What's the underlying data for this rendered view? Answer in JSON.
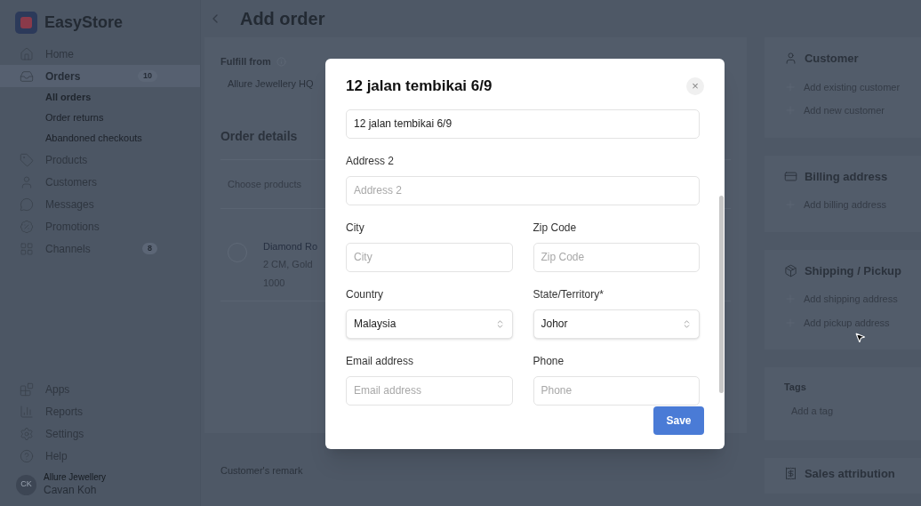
{
  "brand": {
    "name": "EasyStore"
  },
  "sidebar": {
    "items": [
      {
        "kind": "home",
        "label": "Home",
        "selected": false
      },
      {
        "kind": "orders",
        "label": "Orders",
        "selected": true,
        "badge": "10",
        "children": [
          {
            "label": "All orders",
            "selected": true
          },
          {
            "label": "Order returns",
            "selected": false
          },
          {
            "label": "Abandoned checkouts",
            "selected": false
          }
        ]
      },
      {
        "kind": "products",
        "label": "Products",
        "selected": false
      },
      {
        "kind": "customers",
        "label": "Customers",
        "selected": false
      },
      {
        "kind": "messages",
        "label": "Messages",
        "selected": false
      },
      {
        "kind": "promotions",
        "label": "Promotions",
        "selected": false
      },
      {
        "kind": "channels",
        "label": "Channels",
        "selected": false,
        "badge": "8"
      }
    ],
    "bottom_items": [
      {
        "kind": "apps",
        "label": "Apps"
      },
      {
        "kind": "reports",
        "label": "Reports"
      },
      {
        "kind": "settings",
        "label": "Settings"
      },
      {
        "kind": "help",
        "label": "Help"
      }
    ],
    "user": {
      "initials": "CK",
      "store": "Allure Jewellery",
      "name": "Cavan Koh"
    }
  },
  "page": {
    "title": "Add order"
  },
  "main": {
    "fulfill_label": "Fulfill from",
    "fulfill_value": "Allure Jewellery HQ",
    "order_details": "Order details",
    "choose_products": "Choose products",
    "product": {
      "name": "Diamond Ro",
      "variant": "2 CM, Gold",
      "price": "1000"
    },
    "remark_label": "Customer's remark"
  },
  "right_panel": [
    {
      "kind": "customer",
      "title": "Customer",
      "actions": [
        "Add existing customer",
        "Add new customer"
      ]
    },
    {
      "kind": "billing",
      "title": "Billing address",
      "actions": [
        "Add billing address"
      ]
    },
    {
      "kind": "shipping",
      "title": "Shipping / Pickup",
      "actions": [
        "Add shipping address",
        "Add pickup address"
      ]
    },
    {
      "kind": "tags",
      "title": "Tags",
      "placeholder": "Add a tag"
    },
    {
      "kind": "sales",
      "title": "Sales attribution"
    }
  ],
  "modal": {
    "title": "12 jalan tembikai 6/9",
    "close": "×",
    "rows": [
      [
        {
          "kind": "text",
          "value": "12 jalan tembikai 6/9"
        }
      ],
      [
        {
          "kind": "text",
          "label": "Address 2",
          "placeholder": "Address 2"
        }
      ],
      [
        {
          "kind": "text",
          "label": "City",
          "placeholder": "City"
        },
        {
          "kind": "text",
          "label": "Zip Code",
          "placeholder": "Zip Code"
        }
      ],
      [
        {
          "kind": "select",
          "label": "Country",
          "value": "Malaysia"
        },
        {
          "kind": "select",
          "label": "State/Territory*",
          "value": "Johor"
        }
      ],
      [
        {
          "kind": "text",
          "label": "Email address",
          "placeholder": "Email address"
        },
        {
          "kind": "text",
          "label": "Phone",
          "placeholder": "Phone"
        }
      ]
    ],
    "save": "Save"
  }
}
